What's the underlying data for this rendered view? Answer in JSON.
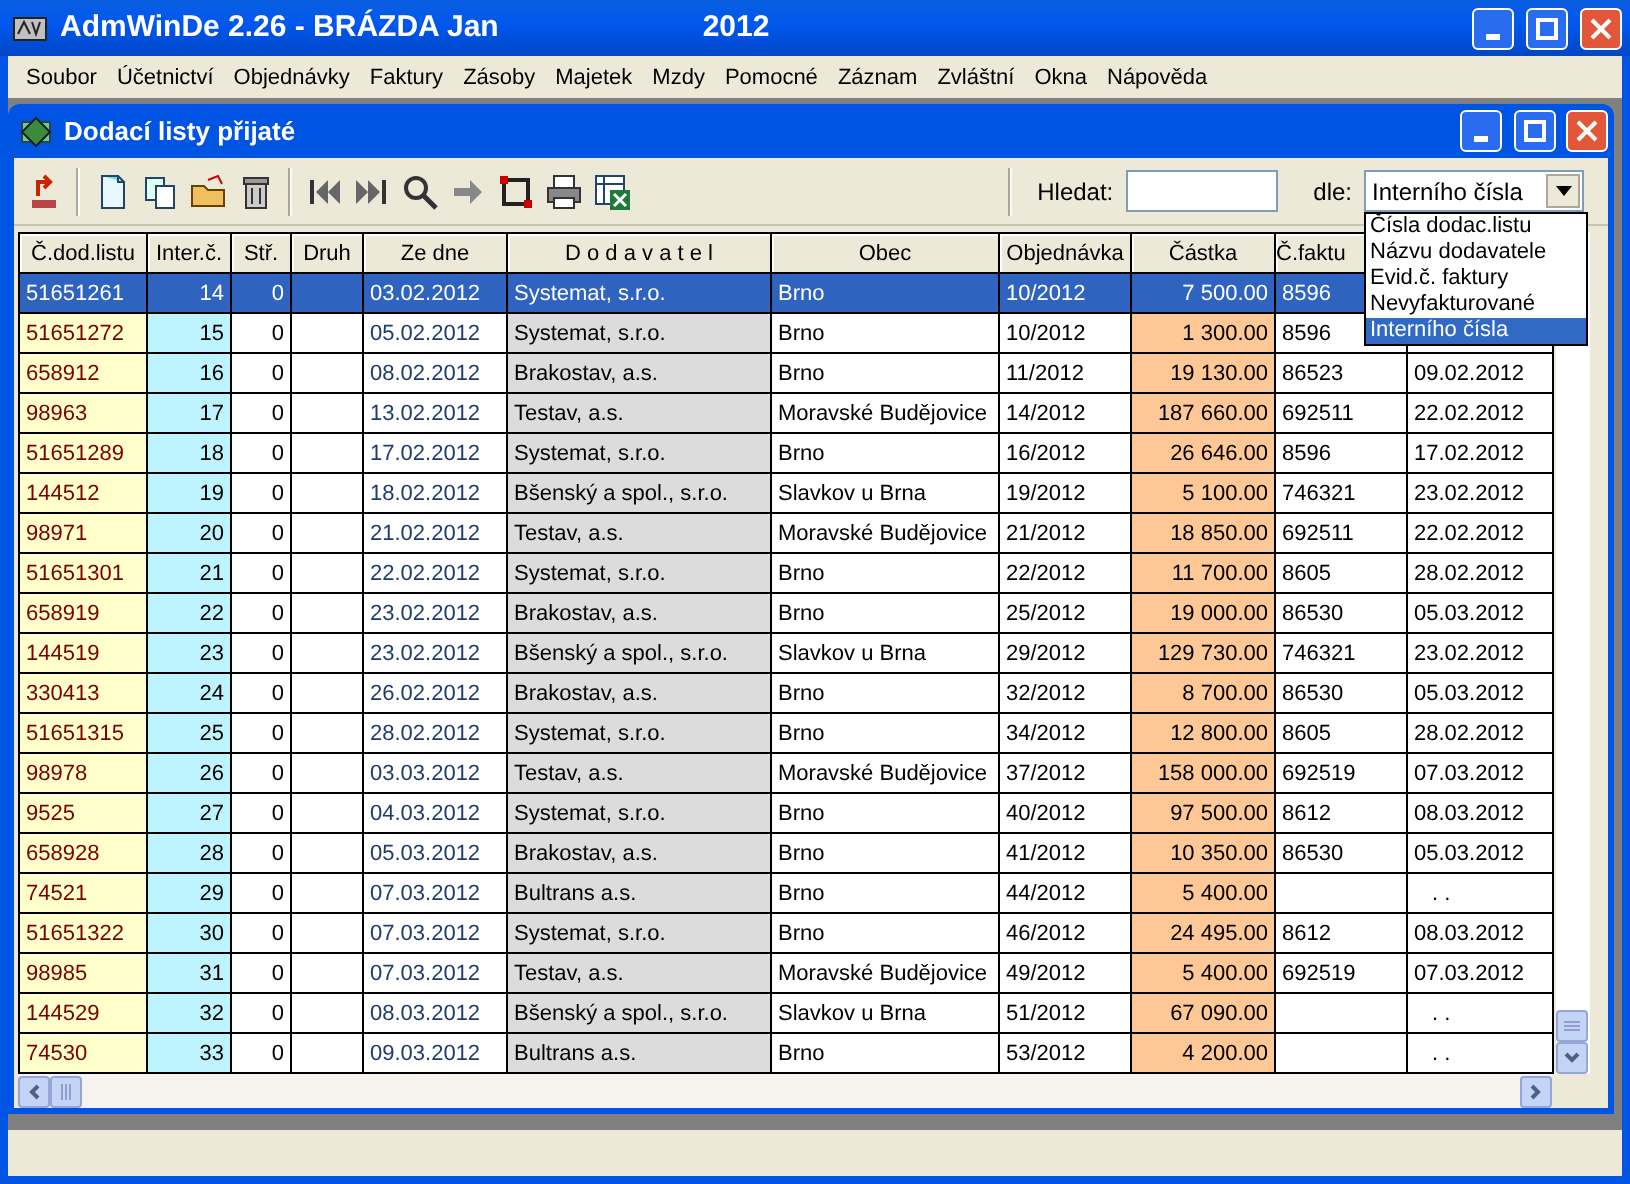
{
  "window": {
    "title": "AdmWinDe 2.26 - BRÁZDA Jan",
    "year": "2012"
  },
  "menu": [
    "Soubor",
    "Účetnictví",
    "Objednávky",
    "Faktury",
    "Zásoby",
    "Majetek",
    "Mzdy",
    "Pomocné",
    "Záznam",
    "Zvláštní",
    "Okna",
    "Nápověda"
  ],
  "child_window": {
    "title": "Dodací listy přijaté"
  },
  "search": {
    "label": "Hledat:",
    "by_label": "dle:",
    "by_value": "Interního čísla",
    "expanded": true,
    "options": [
      {
        "label": "Čísla dodac.listu",
        "selected": false
      },
      {
        "label": "Názvu dodavatele",
        "selected": false
      },
      {
        "label": "Evid.č. faktury",
        "selected": false
      },
      {
        "label": "Nevyfakturované",
        "selected": false
      },
      {
        "label": "Interního čísla",
        "selected": true
      }
    ]
  },
  "table": {
    "columns": [
      "Č.dod.listu",
      "Inter.č.",
      "Stř.",
      "Druh",
      "Ze dne",
      "D o d a v a t e l",
      "Obec",
      "Objednávka",
      "Částka",
      "Č.faktu"
    ],
    "rows": [
      {
        "delivery_no": "51651261",
        "internal_no": "14",
        "center": "0",
        "date": "03.02.2012",
        "supplier": "Systemat, s.r.o.",
        "town": "Brno",
        "order": "10/2012",
        "amount": "7 500.00",
        "invoice_no": "8596",
        "selected": true
      },
      {
        "delivery_no": "51651272",
        "internal_no": "15",
        "center": "0",
        "date": "05.02.2012",
        "supplier": "Systemat, s.r.o.",
        "town": "Brno",
        "order": "10/2012",
        "amount": "1 300.00",
        "invoice_no": "8596",
        "selected": false
      },
      {
        "delivery_no": "658912",
        "internal_no": "16",
        "center": "0",
        "date": "08.02.2012",
        "supplier": "Brakostav, a.s.",
        "town": "Brno",
        "order": "11/2012",
        "amount": "19 130.00",
        "invoice_no": "86523",
        "invoice_date": "09.02.2012",
        "selected": false
      },
      {
        "delivery_no": "98963",
        "internal_no": "17",
        "center": "0",
        "date": "13.02.2012",
        "supplier": "Testav, a.s.",
        "town": "Moravské Budějovice",
        "order": "14/2012",
        "amount": "187 660.00",
        "invoice_no": "692511",
        "invoice_date": "22.02.2012",
        "selected": false
      },
      {
        "delivery_no": "51651289",
        "internal_no": "18",
        "center": "0",
        "date": "17.02.2012",
        "supplier": "Systemat, s.r.o.",
        "town": "Brno",
        "order": "16/2012",
        "amount": "26 646.00",
        "invoice_no": "8596",
        "invoice_date": "17.02.2012",
        "selected": false
      },
      {
        "delivery_no": "144512",
        "internal_no": "19",
        "center": "0",
        "date": "18.02.2012",
        "supplier": "Bšenský a spol., s.r.o.",
        "town": "Slavkov u Brna",
        "order": "19/2012",
        "amount": "5 100.00",
        "invoice_no": "746321",
        "invoice_date": "23.02.2012",
        "selected": false
      },
      {
        "delivery_no": "98971",
        "internal_no": "20",
        "center": "0",
        "date": "21.02.2012",
        "supplier": "Testav, a.s.",
        "town": "Moravské Budějovice",
        "order": "21/2012",
        "amount": "18 850.00",
        "invoice_no": "692511",
        "invoice_date": "22.02.2012",
        "selected": false
      },
      {
        "delivery_no": "51651301",
        "internal_no": "21",
        "center": "0",
        "date": "22.02.2012",
        "supplier": "Systemat, s.r.o.",
        "town": "Brno",
        "order": "22/2012",
        "amount": "11 700.00",
        "invoice_no": "8605",
        "invoice_date": "28.02.2012",
        "selected": false
      },
      {
        "delivery_no": "658919",
        "internal_no": "22",
        "center": "0",
        "date": "23.02.2012",
        "supplier": "Brakostav, a.s.",
        "town": "Brno",
        "order": "25/2012",
        "amount": "19 000.00",
        "invoice_no": "86530",
        "invoice_date": "05.03.2012",
        "selected": false
      },
      {
        "delivery_no": "144519",
        "internal_no": "23",
        "center": "0",
        "date": "23.02.2012",
        "supplier": "Bšenský a spol., s.r.o.",
        "town": "Slavkov u Brna",
        "order": "29/2012",
        "amount": "129 730.00",
        "invoice_no": "746321",
        "invoice_date": "23.02.2012",
        "selected": false
      },
      {
        "delivery_no": "330413",
        "internal_no": "24",
        "center": "0",
        "date": "26.02.2012",
        "supplier": "Brakostav, a.s.",
        "town": "Brno",
        "order": "32/2012",
        "amount": "8 700.00",
        "invoice_no": "86530",
        "invoice_date": "05.03.2012",
        "selected": false
      },
      {
        "delivery_no": "51651315",
        "internal_no": "25",
        "center": "0",
        "date": "28.02.2012",
        "supplier": "Systemat, s.r.o.",
        "town": "Brno",
        "order": "34/2012",
        "amount": "12 800.00",
        "invoice_no": "8605",
        "invoice_date": "28.02.2012",
        "selected": false
      },
      {
        "delivery_no": "98978",
        "internal_no": "26",
        "center": "0",
        "date": "03.03.2012",
        "supplier": "Testav, a.s.",
        "town": "Moravské Budějovice",
        "order": "37/2012",
        "amount": "158 000.00",
        "invoice_no": "692519",
        "invoice_date": "07.03.2012",
        "selected": false
      },
      {
        "delivery_no": "9525",
        "internal_no": "27",
        "center": "0",
        "date": "04.03.2012",
        "supplier": "Systemat, s.r.o.",
        "town": "Brno",
        "order": "40/2012",
        "amount": "97 500.00",
        "invoice_no": "8612",
        "invoice_date": "08.03.2012",
        "selected": false
      },
      {
        "delivery_no": "658928",
        "internal_no": "28",
        "center": "0",
        "date": "05.03.2012",
        "supplier": "Brakostav, a.s.",
        "town": "Brno",
        "order": "41/2012",
        "amount": "10 350.00",
        "invoice_no": "86530",
        "invoice_date": "05.03.2012",
        "selected": false
      },
      {
        "delivery_no": "74521",
        "internal_no": "29",
        "center": "0",
        "date": "07.03.2012",
        "supplier": "Bultrans a.s.",
        "town": "Brno",
        "order": "44/2012",
        "amount": "5 400.00",
        "invoice_date": ". .",
        "selected": false
      },
      {
        "delivery_no": "51651322",
        "internal_no": "30",
        "center": "0",
        "date": "07.03.2012",
        "supplier": "Systemat, s.r.o.",
        "town": "Brno",
        "order": "46/2012",
        "amount": "24 495.00",
        "invoice_no": "8612",
        "invoice_date": "08.03.2012",
        "selected": false
      },
      {
        "delivery_no": "98985",
        "internal_no": "31",
        "center": "0",
        "date": "07.03.2012",
        "supplier": "Testav, a.s.",
        "town": "Moravské Budějovice",
        "order": "49/2012",
        "amount": "5 400.00",
        "invoice_no": "692519",
        "invoice_date": "07.03.2012",
        "selected": false
      },
      {
        "delivery_no": "144529",
        "internal_no": "32",
        "center": "0",
        "date": "08.03.2012",
        "supplier": "Bšenský a spol., s.r.o.",
        "town": "Slavkov u Brna",
        "order": "51/2012",
        "amount": "67 090.00",
        "invoice_date": ". .",
        "selected": false
      },
      {
        "delivery_no": "74530",
        "internal_no": "33",
        "center": "0",
        "date": "09.03.2012",
        "supplier": "Bultrans a.s.",
        "town": "Brno",
        "order": "53/2012",
        "amount": "4 200.00",
        "invoice_date": ". .",
        "selected": false
      }
    ]
  }
}
